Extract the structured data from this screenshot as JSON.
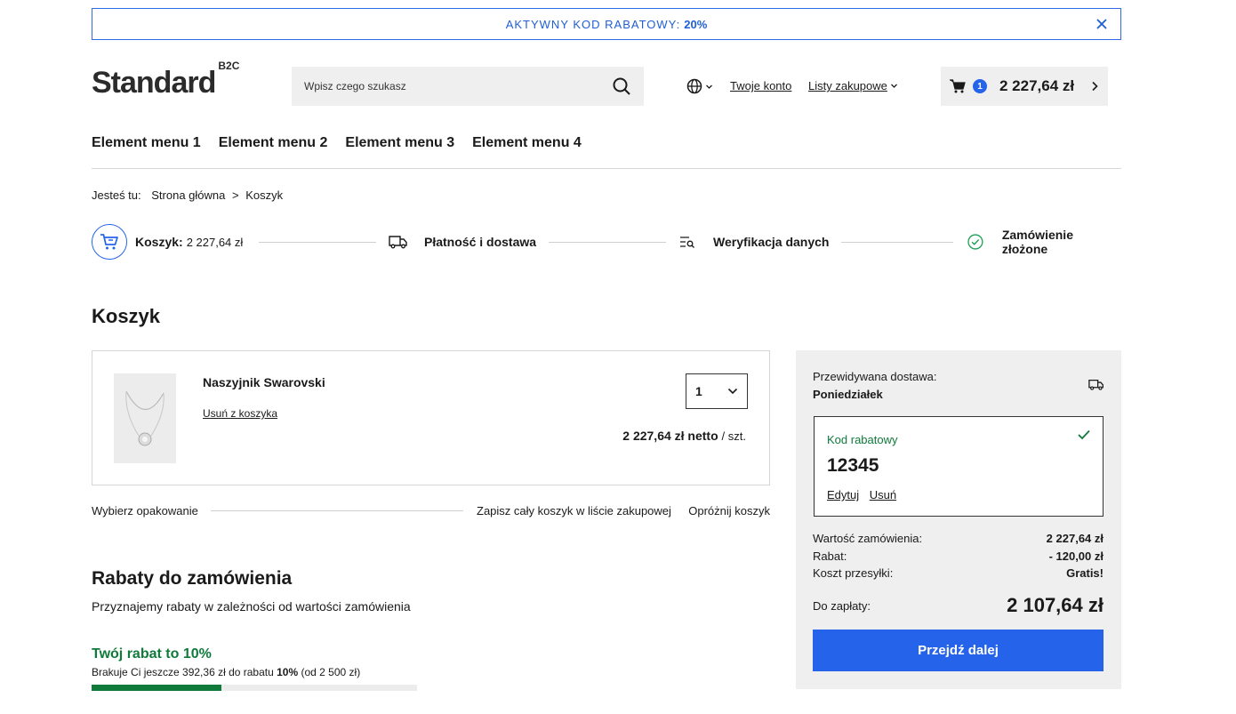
{
  "promo": {
    "label": "AKTYWNY KOD RABATOWY:",
    "value": "20%"
  },
  "header": {
    "logo": "Standard",
    "logo_sup": "B2C",
    "search_placeholder": "Wpisz czego szukasz",
    "account_link": "Twoje konto",
    "lists_link": "Listy zakupowe",
    "cart_count": "1",
    "cart_total": "2 227,64 zł"
  },
  "nav": [
    "Element menu 1",
    "Element menu 2",
    "Element menu 3",
    "Element menu 4"
  ],
  "breadcrumb": {
    "prefix": "Jesteś tu:",
    "home": "Strona główna",
    "separator": ">",
    "current": "Koszyk"
  },
  "steps": {
    "cart_label": "Koszyk:",
    "cart_value": "2 227,64 zł",
    "payment": "Płatność i dostawa",
    "verification": "Weryfikacja danych",
    "done": "Zamówienie złożone"
  },
  "cart": {
    "title": "Koszyk",
    "item": {
      "name": "Naszyjnik Swarovski",
      "remove": "Usuń z koszyka",
      "qty": "1",
      "price": "2 227,64 zł netto",
      "unit": "/ szt."
    },
    "actions": {
      "packaging": "Wybierz opakowanie",
      "save": "Zapisz cały koszyk w liście zakupowej",
      "empty": "Opróżnij koszyk"
    }
  },
  "discounts": {
    "title": "Rabaty do zamówienia",
    "subtitle": "Przyznajemy rabaty w zależności od wartości zamówienia",
    "current": "Twój rabat to 10%",
    "missing_pre": "Brakuje Ci jeszcze 392,36 zł do rabatu",
    "missing_bold": "10%",
    "missing_post": "(od 2 500 zł)",
    "progress": 0.4
  },
  "summary": {
    "delivery_label": "Przewidywana dostawa:",
    "delivery_day": "Poniedziałek",
    "code_label": "Kod rabatowy",
    "code_value": "12345",
    "edit": "Edytuj",
    "remove": "Usuń",
    "order_value_label": "Wartość zamówienia:",
    "order_value": "2 227,64 zł",
    "discount_label": "Rabat:",
    "discount_value": "- 120,00 zł",
    "shipping_label": "Koszt przesyłki:",
    "shipping_value": "Gratis!",
    "topay_label": "Do zapłaty:",
    "topay_value": "2 107,64 zł",
    "cta": "Przejdź dalej"
  },
  "colors": {
    "accent": "#2563eb",
    "success": "#0f7a3a",
    "panel": "#efefef"
  }
}
